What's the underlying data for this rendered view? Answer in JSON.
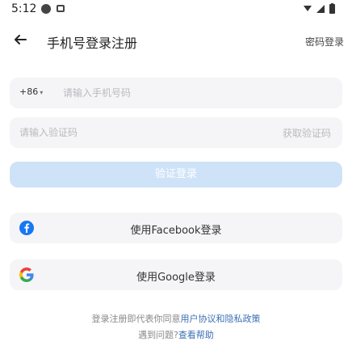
{
  "status_bar": {
    "time": "5:12"
  },
  "nav": {
    "title": "手机号登录注册",
    "password_login": "密码登录"
  },
  "phone": {
    "country_code": "+86",
    "placeholder": "请输入手机号码"
  },
  "code": {
    "placeholder": "请输入验证码",
    "get_code": "获取验证码"
  },
  "primary_button": {
    "label": "验证登录"
  },
  "social": {
    "facebook": {
      "label": "使用Facebook登录",
      "color": "#1877f2"
    },
    "google": {
      "label": "使用Google登录"
    }
  },
  "terms": {
    "prefix": "登录注册即代表你同意",
    "link": "用户协议和隐私政策"
  },
  "help": {
    "prefix": "遇到问题?",
    "link": "查看帮助"
  },
  "colors": {
    "primary_disabled": "#cfe3f8",
    "link": "#3b6fb4",
    "field_bg": "#f5f5f7"
  }
}
